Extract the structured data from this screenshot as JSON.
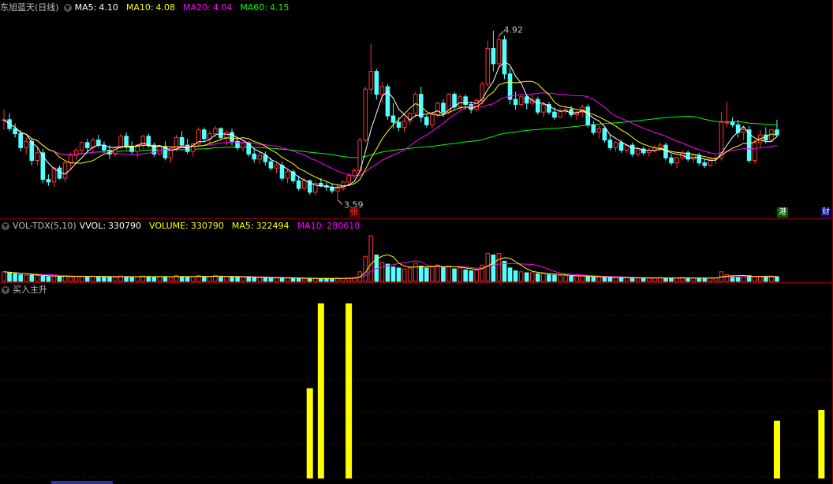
{
  "colors": {
    "up": "#ff3232",
    "down": "#54ffff",
    "ma5": "#ffffff",
    "ma10": "#ffff00",
    "ma20": "#ff00ff",
    "ma60": "#00ff00",
    "volbar": "#ff00ff",
    "signal": "#ffff00",
    "grid": "#8b0000",
    "text": "#c0c0c0"
  },
  "price_panel": {
    "title": "东旭蓝天(日线)",
    "indicators": [
      {
        "label": "MA5:",
        "value": "4.10",
        "color": "#ffffff"
      },
      {
        "label": "MA10:",
        "value": "4.08",
        "color": "#ffff00"
      },
      {
        "label": "MA20:",
        "value": "4.04",
        "color": "#ff00ff"
      },
      {
        "label": "MA60:",
        "value": "4.15",
        "color": "#00ff00"
      }
    ],
    "high_label": "4.92",
    "low_label": "3.59",
    "badges": [
      {
        "text": "张",
        "color": "#ff3232",
        "bg": "#550000"
      },
      {
        "text": "港",
        "color": "#ffffff",
        "bg": "#006000"
      },
      {
        "text": "财",
        "color": "#ffffff",
        "bg": "#000070"
      }
    ]
  },
  "volume_panel": {
    "title": "VOL-TDX(5,10)",
    "indicators": [
      {
        "label": "VVOL:",
        "value": "330790",
        "color": "#ffffff"
      },
      {
        "label": "VOLUME:",
        "value": "330790",
        "color": "#ffff00"
      },
      {
        "label": "MA5:",
        "value": "322494",
        "color": "#ffff00"
      },
      {
        "label": "MA10:",
        "value": "280618",
        "color": "#ff00ff"
      }
    ]
  },
  "signal_panel": {
    "title": "买入主升"
  },
  "chart_data": {
    "type": "candlestick",
    "price_range": [
      3.5,
      5.05
    ],
    "candles": [
      [
        4.22,
        4.3,
        4.14,
        4.22
      ],
      [
        4.22,
        4.27,
        4.13,
        4.15
      ],
      [
        4.15,
        4.19,
        4.08,
        4.11
      ],
      [
        4.11,
        4.14,
        3.97,
        4.0
      ],
      [
        4.0,
        4.08,
        3.95,
        4.05
      ],
      [
        4.05,
        4.07,
        3.86,
        3.9
      ],
      [
        3.9,
        4.0,
        3.86,
        3.96
      ],
      [
        3.96,
        3.99,
        3.72,
        3.75
      ],
      [
        3.75,
        3.79,
        3.7,
        3.73
      ],
      [
        3.73,
        3.85,
        3.69,
        3.84
      ],
      [
        3.84,
        3.86,
        3.75,
        3.76
      ],
      [
        3.76,
        3.89,
        3.73,
        3.88
      ],
      [
        3.88,
        3.96,
        3.83,
        3.94
      ],
      [
        3.94,
        4.0,
        3.9,
        3.98
      ],
      [
        3.98,
        4.05,
        3.94,
        4.04
      ],
      [
        4.04,
        4.07,
        3.97,
        4.0
      ],
      [
        4.0,
        4.08,
        3.96,
        4.06
      ],
      [
        4.06,
        4.1,
        4.0,
        4.02
      ],
      [
        4.02,
        4.05,
        3.96,
        3.98
      ],
      [
        3.98,
        4.02,
        3.91,
        3.95
      ],
      [
        3.95,
        4.01,
        3.93,
        4.0
      ],
      [
        4.0,
        4.11,
        3.99,
        4.09
      ],
      [
        4.09,
        4.12,
        3.99,
        4.01
      ],
      [
        4.01,
        4.05,
        3.95,
        3.97
      ],
      [
        3.97,
        4.03,
        3.92,
        4.02
      ],
      [
        4.02,
        4.1,
        3.99,
        4.09
      ],
      [
        4.09,
        4.11,
        4.0,
        4.02
      ],
      [
        4.02,
        4.04,
        3.93,
        3.95
      ],
      [
        3.95,
        4.02,
        3.94,
        4.01
      ],
      [
        4.01,
        4.05,
        3.9,
        3.92
      ],
      [
        3.92,
        4.0,
        3.88,
        3.99
      ],
      [
        3.99,
        4.1,
        3.97,
        4.08
      ],
      [
        4.08,
        4.13,
        4.0,
        4.02
      ],
      [
        4.02,
        4.07,
        3.95,
        3.97
      ],
      [
        3.97,
        4.04,
        3.93,
        4.03
      ],
      [
        4.03,
        4.16,
        4.01,
        4.14
      ],
      [
        4.14,
        4.16,
        4.05,
        4.07
      ],
      [
        4.07,
        4.13,
        4.02,
        4.11
      ],
      [
        4.11,
        4.17,
        4.08,
        4.15
      ],
      [
        4.15,
        4.16,
        4.06,
        4.08
      ],
      [
        4.08,
        4.14,
        4.02,
        4.12
      ],
      [
        4.12,
        4.15,
        4.02,
        4.05
      ],
      [
        4.05,
        4.08,
        3.98,
        4.0
      ],
      [
        4.0,
        4.06,
        3.97,
        4.04
      ],
      [
        4.04,
        4.05,
        3.93,
        3.95
      ],
      [
        3.95,
        3.99,
        3.88,
        3.91
      ],
      [
        3.91,
        3.97,
        3.87,
        3.94
      ],
      [
        3.94,
        3.97,
        3.86,
        3.89
      ],
      [
        3.89,
        3.92,
        3.82,
        3.84
      ],
      [
        3.84,
        3.88,
        3.8,
        3.86
      ],
      [
        3.86,
        3.89,
        3.74,
        3.76
      ],
      [
        3.76,
        3.83,
        3.72,
        3.81
      ],
      [
        3.81,
        3.83,
        3.72,
        3.74
      ],
      [
        3.74,
        3.78,
        3.66,
        3.68
      ],
      [
        3.68,
        3.76,
        3.66,
        3.74
      ],
      [
        3.74,
        3.75,
        3.63,
        3.65
      ],
      [
        3.65,
        3.74,
        3.63,
        3.72
      ],
      [
        3.72,
        3.76,
        3.69,
        3.7
      ],
      [
        3.7,
        3.73,
        3.66,
        3.69
      ],
      [
        3.69,
        3.72,
        3.64,
        3.66
      ],
      [
        3.66,
        3.72,
        3.59,
        3.68
      ],
      [
        3.68,
        3.74,
        3.66,
        3.73
      ],
      [
        3.73,
        3.8,
        3.71,
        3.78
      ],
      [
        3.78,
        3.84,
        3.76,
        3.82
      ],
      [
        3.82,
        4.08,
        3.8,
        4.06
      ],
      [
        4.06,
        4.48,
        4.04,
        4.46
      ],
      [
        4.46,
        4.82,
        4.42,
        4.6
      ],
      [
        4.6,
        4.62,
        4.38,
        4.42
      ],
      [
        4.42,
        4.52,
        4.35,
        4.48
      ],
      [
        4.48,
        4.5,
        4.22,
        4.25
      ],
      [
        4.25,
        4.35,
        4.15,
        4.2
      ],
      [
        4.2,
        4.24,
        4.13,
        4.16
      ],
      [
        4.16,
        4.24,
        4.12,
        4.21
      ],
      [
        4.21,
        4.28,
        4.18,
        4.27
      ],
      [
        4.27,
        4.44,
        4.24,
        4.42
      ],
      [
        4.42,
        4.48,
        4.2,
        4.24
      ],
      [
        4.24,
        4.26,
        4.16,
        4.18
      ],
      [
        4.18,
        4.28,
        4.15,
        4.26
      ],
      [
        4.26,
        4.36,
        4.24,
        4.35
      ],
      [
        4.35,
        4.38,
        4.24,
        4.28
      ],
      [
        4.28,
        4.43,
        4.26,
        4.42
      ],
      [
        4.42,
        4.44,
        4.3,
        4.32
      ],
      [
        4.32,
        4.42,
        4.3,
        4.4
      ],
      [
        4.4,
        4.42,
        4.3,
        4.34
      ],
      [
        4.34,
        4.36,
        4.27,
        4.3
      ],
      [
        4.3,
        4.39,
        4.28,
        4.37
      ],
      [
        4.37,
        4.52,
        4.34,
        4.5
      ],
      [
        4.5,
        4.84,
        4.48,
        4.78
      ],
      [
        4.78,
        4.92,
        4.6,
        4.66
      ],
      [
        4.66,
        4.88,
        4.62,
        4.85
      ],
      [
        4.85,
        4.88,
        4.54,
        4.58
      ],
      [
        4.58,
        4.63,
        4.34,
        4.38
      ],
      [
        4.38,
        4.44,
        4.3,
        4.34
      ],
      [
        4.34,
        4.42,
        4.32,
        4.4
      ],
      [
        4.4,
        4.41,
        4.3,
        4.35
      ],
      [
        4.35,
        4.42,
        4.33,
        4.38
      ],
      [
        4.38,
        4.4,
        4.26,
        4.28
      ],
      [
        4.28,
        4.36,
        4.24,
        4.34
      ],
      [
        4.34,
        4.36,
        4.26,
        4.28
      ],
      [
        4.28,
        4.32,
        4.22,
        4.24
      ],
      [
        4.24,
        4.31,
        4.23,
        4.29
      ],
      [
        4.29,
        4.33,
        4.26,
        4.3
      ],
      [
        4.3,
        4.33,
        4.24,
        4.26
      ],
      [
        4.26,
        4.29,
        4.22,
        4.28
      ],
      [
        4.28,
        4.34,
        4.24,
        4.32
      ],
      [
        4.32,
        4.34,
        4.16,
        4.18
      ],
      [
        4.18,
        4.21,
        4.1,
        4.12
      ],
      [
        4.12,
        4.17,
        4.07,
        4.15
      ],
      [
        4.15,
        4.16,
        4.04,
        4.06
      ],
      [
        4.06,
        4.1,
        3.98,
        4.0
      ],
      [
        4.0,
        4.05,
        3.97,
        4.04
      ],
      [
        4.04,
        4.06,
        3.96,
        3.98
      ],
      [
        3.98,
        4.03,
        3.96,
        4.02
      ],
      [
        4.02,
        4.04,
        3.93,
        3.95
      ],
      [
        3.95,
        4.0,
        3.93,
        3.99
      ],
      [
        3.99,
        4.01,
        3.94,
        3.96
      ],
      [
        3.96,
        4.0,
        3.93,
        3.98
      ],
      [
        3.98,
        4.02,
        3.96,
        4.0
      ],
      [
        4.0,
        4.04,
        3.97,
        4.02
      ],
      [
        4.02,
        4.04,
        3.9,
        3.92
      ],
      [
        3.92,
        3.95,
        3.86,
        3.88
      ],
      [
        3.88,
        3.93,
        3.84,
        3.92
      ],
      [
        3.92,
        3.98,
        3.9,
        3.96
      ],
      [
        3.96,
        3.98,
        3.89,
        3.91
      ],
      [
        3.91,
        3.95,
        3.88,
        3.94
      ],
      [
        3.94,
        3.96,
        3.86,
        3.88
      ],
      [
        3.88,
        3.91,
        3.84,
        3.86
      ],
      [
        3.86,
        3.92,
        3.85,
        3.91
      ],
      [
        3.91,
        3.94,
        3.87,
        3.92
      ],
      [
        3.92,
        4.28,
        3.9,
        4.2
      ],
      [
        4.2,
        4.36,
        4.16,
        4.2
      ],
      [
        4.2,
        4.24,
        4.16,
        4.18
      ],
      [
        4.18,
        4.22,
        4.08,
        4.12
      ],
      [
        4.12,
        4.16,
        4.06,
        4.14
      ],
      [
        4.14,
        4.17,
        3.88,
        3.9
      ],
      [
        3.9,
        4.06,
        3.88,
        4.04
      ],
      [
        4.04,
        4.14,
        4.0,
        4.1
      ],
      [
        4.1,
        4.16,
        4.03,
        4.06
      ],
      [
        4.06,
        4.15,
        4.04,
        4.14
      ],
      [
        4.14,
        4.22,
        4.08,
        4.1
      ]
    ],
    "volumes": [
      0.2,
      0.18,
      0.16,
      0.14,
      0.13,
      0.13,
      0.12,
      0.11,
      0.1,
      0.11,
      0.1,
      0.11,
      0.1,
      0.1,
      0.11,
      0.1,
      0.11,
      0.1,
      0.1,
      0.09,
      0.09,
      0.11,
      0.1,
      0.09,
      0.1,
      0.11,
      0.1,
      0.09,
      0.1,
      0.1,
      0.09,
      0.12,
      0.1,
      0.09,
      0.1,
      0.12,
      0.1,
      0.1,
      0.12,
      0.1,
      0.1,
      0.1,
      0.09,
      0.09,
      0.09,
      0.08,
      0.08,
      0.08,
      0.07,
      0.07,
      0.08,
      0.07,
      0.07,
      0.06,
      0.06,
      0.06,
      0.06,
      0.06,
      0.06,
      0.06,
      0.07,
      0.06,
      0.07,
      0.08,
      0.2,
      0.52,
      0.95,
      0.55,
      0.4,
      0.36,
      0.3,
      0.28,
      0.26,
      0.28,
      0.38,
      0.32,
      0.28,
      0.3,
      0.34,
      0.3,
      0.32,
      0.26,
      0.28,
      0.24,
      0.22,
      0.24,
      0.34,
      0.58,
      0.55,
      0.58,
      0.42,
      0.28,
      0.22,
      0.2,
      0.18,
      0.18,
      0.16,
      0.16,
      0.14,
      0.13,
      0.12,
      0.12,
      0.11,
      0.11,
      0.11,
      0.1,
      0.09,
      0.09,
      0.08,
      0.08,
      0.08,
      0.08,
      0.08,
      0.07,
      0.07,
      0.07,
      0.07,
      0.07,
      0.08,
      0.07,
      0.07,
      0.07,
      0.08,
      0.07,
      0.07,
      0.07,
      0.07,
      0.07,
      0.07,
      0.2,
      0.14,
      0.1,
      0.09,
      0.09,
      0.12,
      0.1,
      0.1,
      0.09,
      0.1,
      0.1
    ],
    "signals": [
      {
        "index": 55,
        "value": 0.5
      },
      {
        "index": 57,
        "value": 0.97
      },
      {
        "index": 62,
        "value": 0.97
      },
      {
        "index": 139,
        "value": 0.32
      },
      {
        "index": 147,
        "value": 0.38
      }
    ],
    "low_index": 60,
    "high_index": 89
  }
}
